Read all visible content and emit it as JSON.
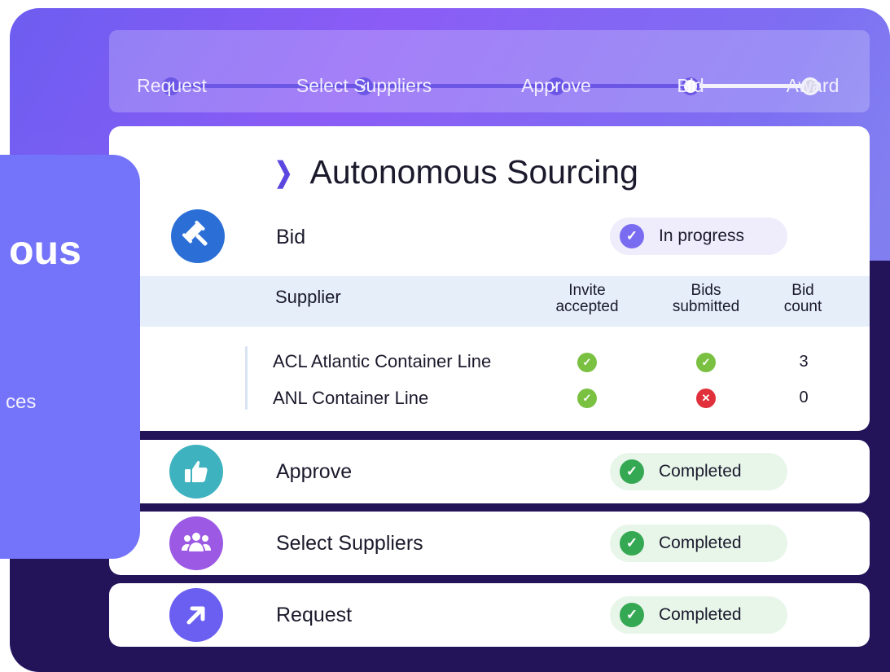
{
  "stepper": {
    "steps": [
      {
        "label": "Request",
        "state": "done"
      },
      {
        "label": "Select Suppliers",
        "state": "done"
      },
      {
        "label": "Approve",
        "state": "done"
      },
      {
        "label": "Bid",
        "state": "current"
      },
      {
        "label": "Award",
        "state": "todo"
      }
    ]
  },
  "left_card": {
    "title_fragment": "ous",
    "subtitle_fragment": "ces"
  },
  "main": {
    "title": "Autonomous Sourcing",
    "stage": {
      "label": "Bid",
      "status": "In progress",
      "icon": "gavel-icon"
    },
    "table": {
      "headers": {
        "supplier": "Supplier",
        "invite_l1": "Invite",
        "invite_l2": "accepted",
        "bids_l1": "Bids",
        "bids_l2": "submitted",
        "count_l1": "Bid",
        "count_l2": "count"
      },
      "rows": [
        {
          "supplier": "ACL Atlantic Container Line",
          "invite_accepted": true,
          "bids_submitted": true,
          "bid_count": "3"
        },
        {
          "supplier": "ANL Container Line",
          "invite_accepted": true,
          "bids_submitted": false,
          "bid_count": "0"
        }
      ]
    }
  },
  "stages": [
    {
      "label": "Approve",
      "status": "Completed",
      "icon": "thumbs-up-icon",
      "color": "#3fb2bf"
    },
    {
      "label": "Select Suppliers",
      "status": "Completed",
      "icon": "people-icon",
      "color": "#9b59e4"
    },
    {
      "label": "Request",
      "status": "Completed",
      "icon": "arrow-up-right-icon",
      "color": "#6a5ff0"
    }
  ],
  "colors": {
    "accent": "#6b56e6",
    "gavel_bg": "#2b6fd6",
    "ok": "#7ac142",
    "fail": "#e0303c",
    "complete": "#35a853"
  }
}
